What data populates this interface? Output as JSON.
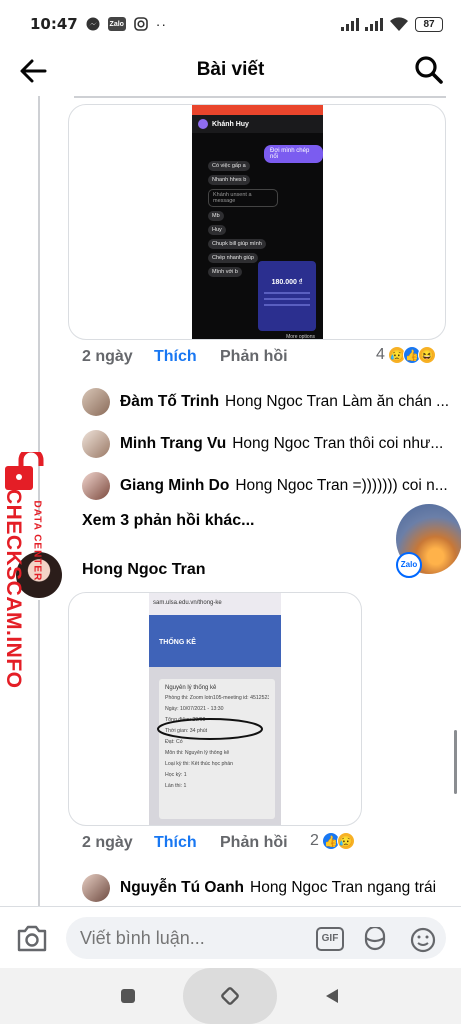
{
  "status_bar": {
    "time": "10:47",
    "battery": "87",
    "dots": "··"
  },
  "header": {
    "title": "Bài viết"
  },
  "comment1": {
    "time": "2 ngày",
    "like_label": "Thích",
    "reply_label": "Phản hồi",
    "reaction_count": "4",
    "reactions": [
      "sad",
      "like",
      "haha"
    ],
    "screenshot": {
      "contact": "Khánh Huy",
      "msgs_left": [
        "Có việc gấp a",
        "Nhanh hhes b",
        "Khánh unsent a message",
        "Mb",
        "Huy",
        "Chupk bill giúp mình",
        "Chép nhanh giúp",
        "Mình với b"
      ],
      "msg_right": "Đợi mình chép nối",
      "amount": "180.000 ₫",
      "footer": "More options"
    }
  },
  "replies": [
    {
      "name": "Đàm Tố Trinh",
      "text": "Hong Ngoc Tran Làm ăn chán ..."
    },
    {
      "name": "Minh Trang Vu",
      "text": "Hong Ngoc Tran thôi coi như..."
    },
    {
      "name": "Giang Minh Do",
      "text": "Hong Ngoc Tran =))))))) coi n..."
    }
  ],
  "more_replies": "Xem 3 phản hồi khác...",
  "comment2": {
    "author": "Hong Ngoc Tran",
    "time": "2 ngày",
    "like_label": "Thích",
    "reply_label": "Phản hồi",
    "reaction_count": "2",
    "reactions": [
      "like",
      "sad"
    ],
    "photo": {
      "url": "sam.ulsa.edu.vn/thong-ke",
      "heading": "THỐNG KÊ",
      "subheading": "Nguyên lý thống kê",
      "lines": [
        "Phòng thi: Zoom lotn105-meeting id: 4512523446",
        "Ngày: 10/07/2021 - 13:30",
        "Tổng điểm: 20/60",
        "Thời gian: 34 phút",
        "Đạt: Có",
        "Môn thi: Nguyên lý thống kê",
        "Loại kỳ thi: Kết thúc học phần",
        "Học kỳ: 1",
        "Lần thi: 1"
      ]
    }
  },
  "reply_last": {
    "name": "Nguyễn Tú Oanh",
    "text": "Hong Ngoc Tran  ngang trái"
  },
  "composer": {
    "placeholder": "Viết bình luận...",
    "gif_label": "GIF"
  },
  "floating": {
    "zalo_label": "Zalo"
  },
  "watermark": {
    "brand": "CHECKSCAM.INFO",
    "sub": "DATA CENTER"
  },
  "colors": {
    "accent": "#1877f2",
    "watermark": "#e41e26"
  }
}
